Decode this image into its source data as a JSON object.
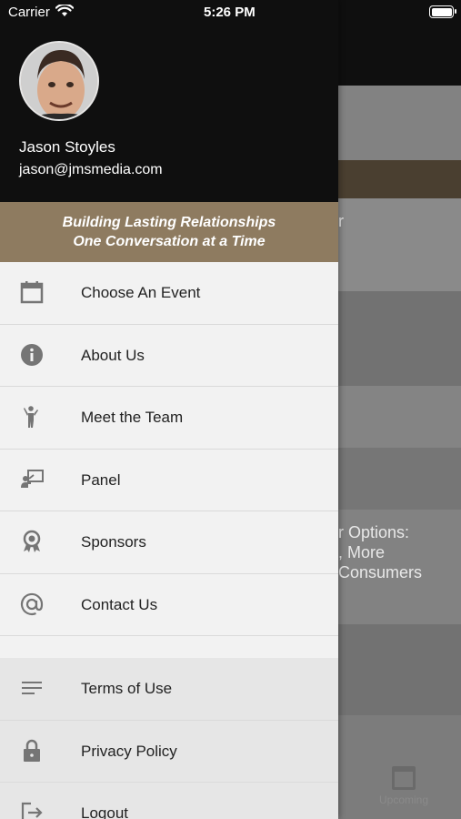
{
  "status_bar": {
    "carrier": "Carrier",
    "time": "5:26 PM"
  },
  "user": {
    "name": "Jason Stoyles",
    "email": "jason@jmsmedia.com"
  },
  "banner": {
    "line1": "Building Lasting Relationships",
    "line2": "One Conversation at a Time"
  },
  "menu": {
    "items": [
      {
        "label": "Choose An Event",
        "icon": "calendar-icon"
      },
      {
        "label": "About Us",
        "icon": "info-icon"
      },
      {
        "label": "Meet the Team",
        "icon": "person-waving-icon"
      },
      {
        "label": "Panel",
        "icon": "presenter-icon"
      },
      {
        "label": "Sponsors",
        "icon": "award-ribbon-icon"
      },
      {
        "label": "Contact Us",
        "icon": "at-sign-icon"
      }
    ],
    "secondary": [
      {
        "label": "Terms of Use",
        "icon": "lines-icon"
      },
      {
        "label": "Privacy Policy",
        "icon": "lock-icon"
      },
      {
        "label": "Logout",
        "icon": "logout-icon"
      }
    ]
  },
  "background": {
    "partial_text_1": "r",
    "partial_text_2": "r Options:",
    "partial_text_3": ", More",
    "partial_text_4": "Consumers",
    "tab_label": "Upcoming"
  },
  "colors": {
    "header_bg": "#0f0f0f",
    "banner_bg": "#8e7b60",
    "drawer_bg": "#f2f2f2"
  }
}
